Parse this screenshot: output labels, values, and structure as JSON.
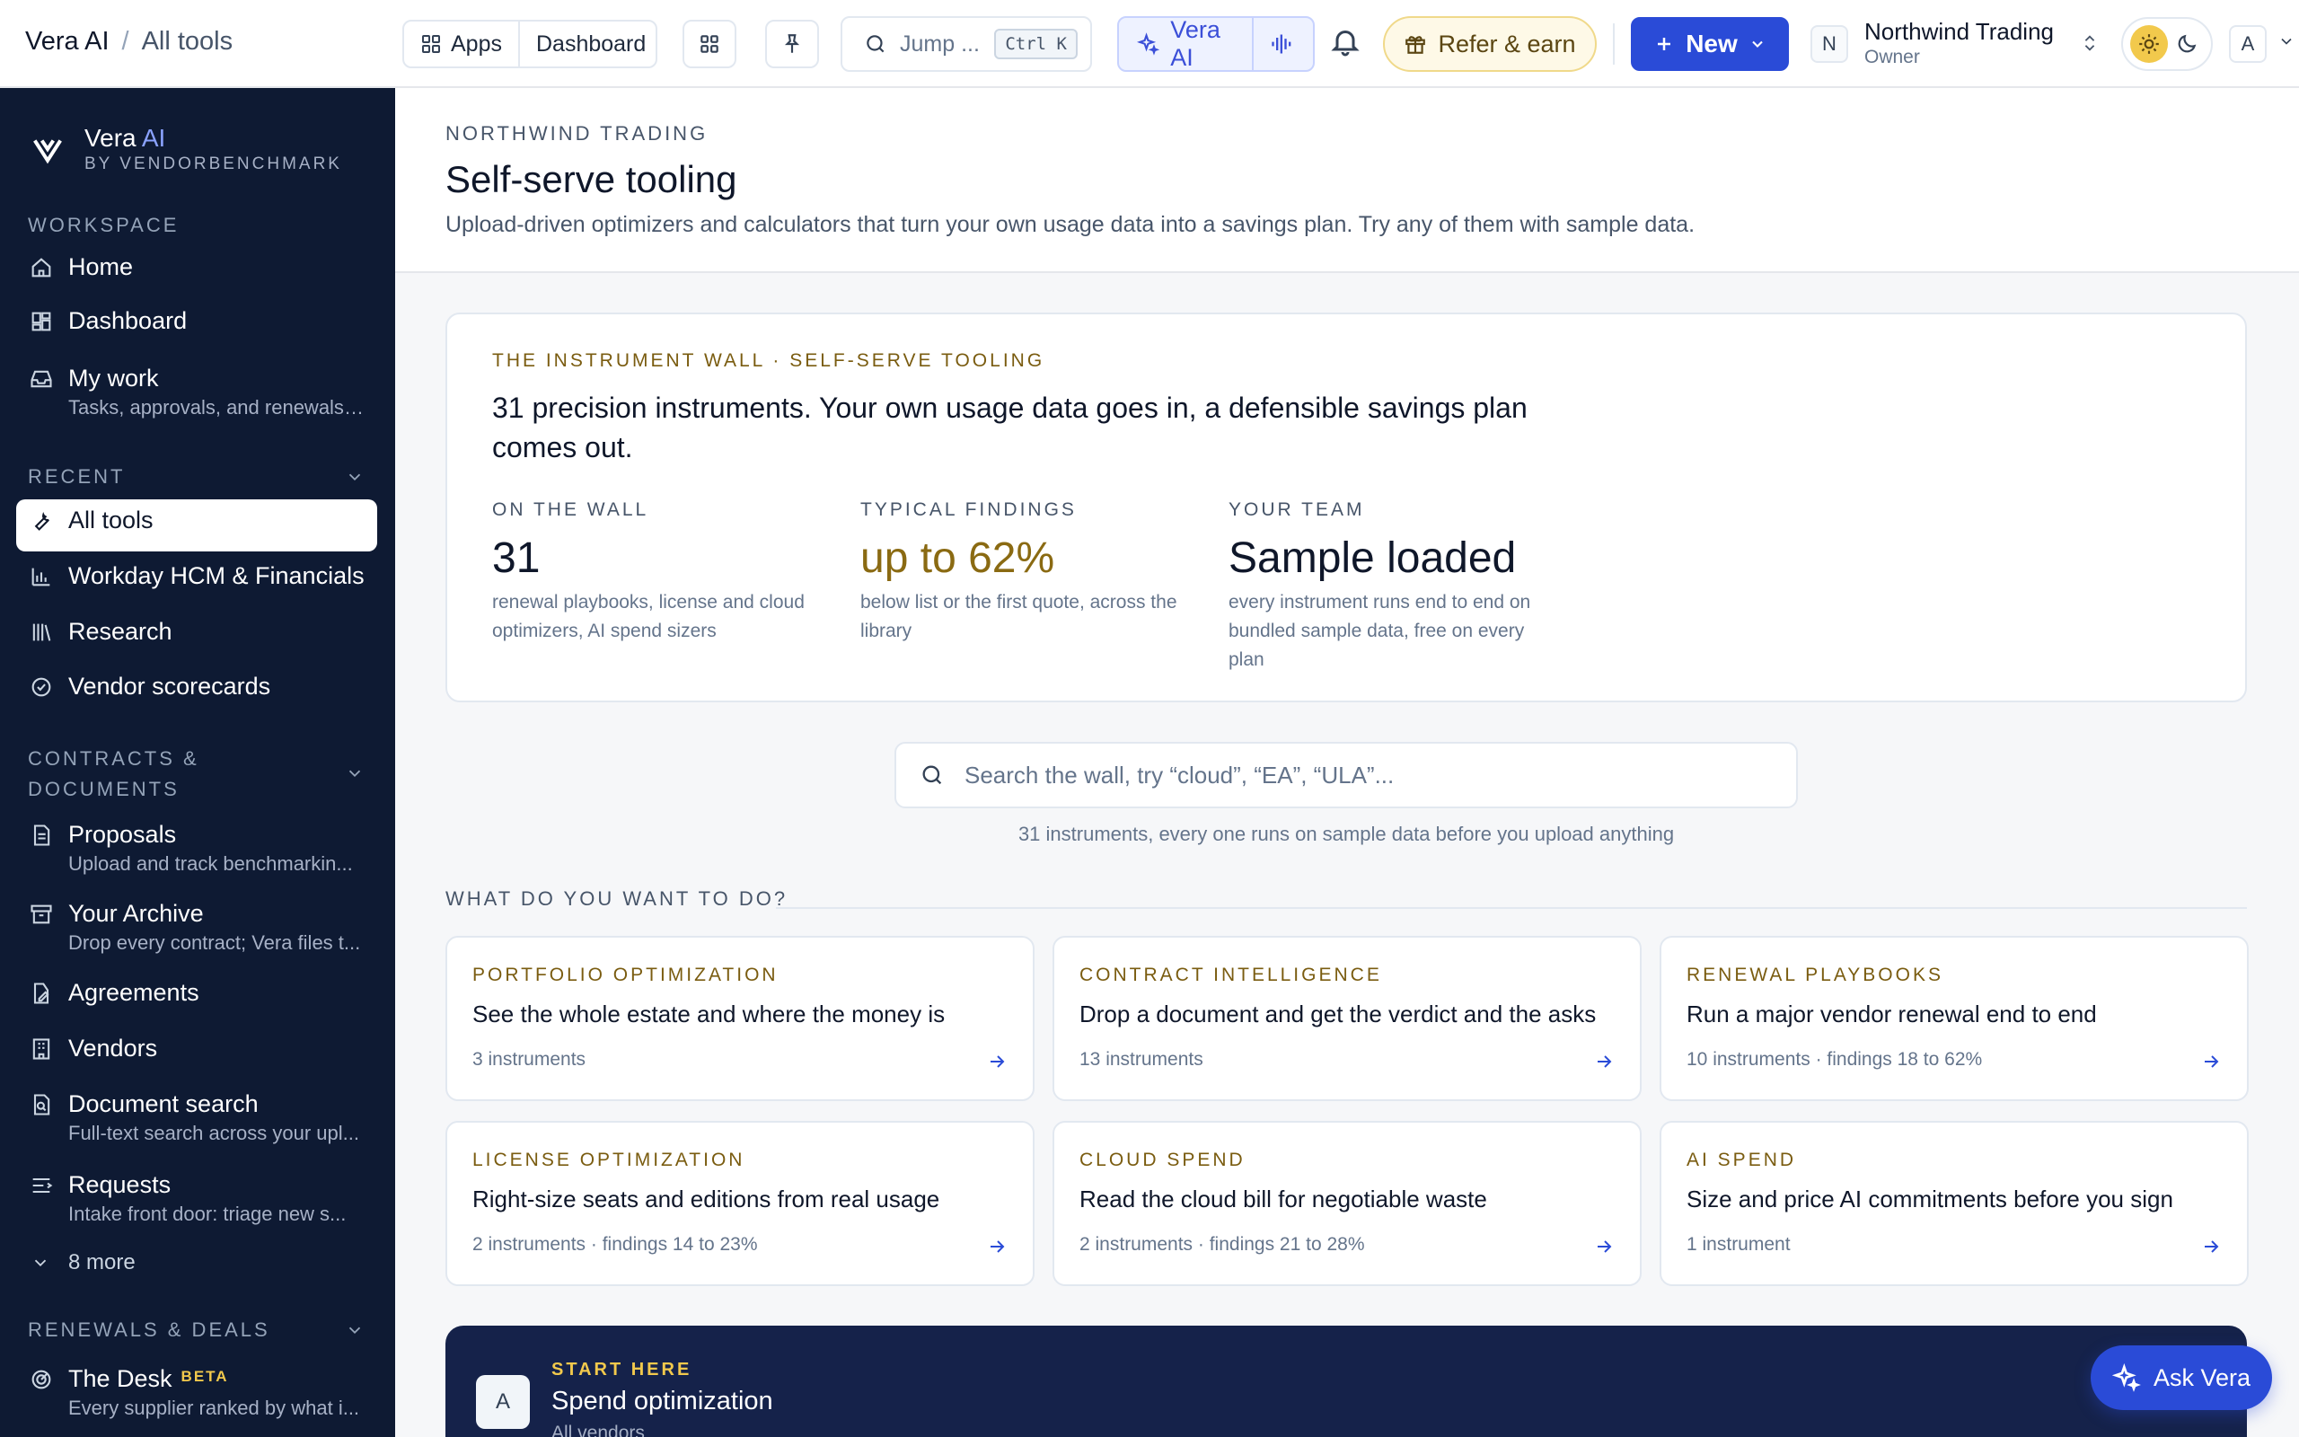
{
  "topbar": {
    "app_name": "Vera AI",
    "breadcrumb_sep": "/",
    "page": "All tools",
    "apps_label": "Apps",
    "dashboard_label": "Dashboard",
    "search_placeholder": "Jump ...",
    "search_shortcut": "Ctrl K",
    "vera_label": "Vera AI",
    "refer_label": "Refer & earn",
    "new_label": "New",
    "org_initial": "N",
    "org_name": "Northwind Trading",
    "org_role": "Owner",
    "user_initial": "A"
  },
  "sidebar": {
    "brand_name": "Vera",
    "brand_ai": "AI",
    "brand_by": "BY VENDORBENCHMARK",
    "sections": {
      "workspace": "WORKSPACE",
      "recent": "RECENT",
      "contracts_line1": "CONTRACTS &",
      "contracts_line2": "DOCUMENTS",
      "renewals": "RENEWALS & DEALS"
    },
    "workspace_items": [
      {
        "label": "Home"
      },
      {
        "label": "Dashboard"
      },
      {
        "label": "My work",
        "sub": "Tasks, approvals, and renewals ..."
      }
    ],
    "recent_items": [
      {
        "label": "All tools"
      },
      {
        "label": "Workday HCM & Financials"
      },
      {
        "label": "Research"
      },
      {
        "label": "Vendor scorecards"
      }
    ],
    "contract_items": [
      {
        "label": "Proposals",
        "sub": "Upload and track benchmarkin..."
      },
      {
        "label": "Your Archive",
        "sub": "Drop every contract; Vera files t..."
      },
      {
        "label": "Agreements"
      },
      {
        "label": "Vendors"
      },
      {
        "label": "Document search",
        "sub": "Full-text search across your upl..."
      },
      {
        "label": "Requests",
        "sub": "Intake front door: triage new s..."
      }
    ],
    "more_label": "8 more",
    "renewal_items": [
      {
        "label": "The Desk",
        "badge": "BETA",
        "sub": "Every supplier ranked by what i..."
      }
    ]
  },
  "header": {
    "eyebrow": "NORTHWIND TRADING",
    "title": "Self-serve tooling",
    "subtitle": "Upload-driven optimizers and calculators that turn your own usage data into a savings plan. Try any of them with sample data."
  },
  "hero": {
    "kicker": "THE INSTRUMENT WALL · SELF-SERVE TOOLING",
    "lead": "31 precision instruments. Your own usage data goes in, a defensible savings plan comes out.",
    "stats": [
      {
        "heading": "ON THE WALL",
        "value": "31",
        "desc": "renewal playbooks, license and cloud optimizers, AI spend sizers"
      },
      {
        "heading": "TYPICAL FINDINGS",
        "value": "up to 62%",
        "desc": "below list or the first quote, across the library"
      },
      {
        "heading": "YOUR TEAM",
        "value": "Sample loaded",
        "desc": "every instrument runs end to end on bundled sample data, free on every plan"
      }
    ]
  },
  "wall_search": {
    "placeholder": "Search the wall, try “cloud”, “EA”, “ULA”...",
    "count_text": "31 instruments, every one runs on sample data before you upload anything"
  },
  "what_heading": "WHAT DO YOU WANT TO DO?",
  "categories": [
    {
      "kicker": "PORTFOLIO OPTIMIZATION",
      "title": "See the whole estate and where the money is",
      "meta": "3 instruments"
    },
    {
      "kicker": "CONTRACT INTELLIGENCE",
      "title": "Drop a document and get the verdict and the asks",
      "meta": "13 instruments"
    },
    {
      "kicker": "RENEWAL PLAYBOOKS",
      "title": "Run a major vendor renewal end to end",
      "meta": "10 instruments · findings 18 to 62%"
    },
    {
      "kicker": "LICENSE OPTIMIZATION",
      "title": "Right-size seats and editions from real usage",
      "meta": "2 instruments · findings 14 to 23%"
    },
    {
      "kicker": "CLOUD SPEND",
      "title": "Read the cloud bill for negotiable waste",
      "meta": "2 instruments · findings 21 to 28%"
    },
    {
      "kicker": "AI SPEND",
      "title": "Size and price AI commitments before you sign",
      "meta": "1 instrument"
    }
  ],
  "start_here": {
    "avatar": "A",
    "kicker": "START HERE",
    "title": "Spend optimization",
    "sub": "All vendors"
  },
  "ask_vera": "Ask Vera",
  "colors": {
    "primary": "#2a4bd7",
    "sidebar_bg": "#0e1a33",
    "gold": "#7a5c10",
    "banner_bg": "#15224a"
  }
}
